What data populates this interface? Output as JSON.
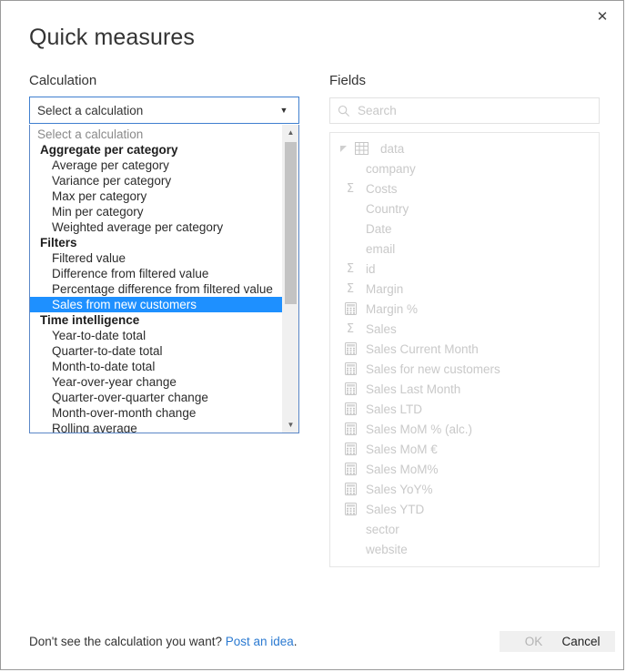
{
  "dialog": {
    "title": "Quick measures",
    "close_icon": "close-icon"
  },
  "calculation": {
    "label": "Calculation",
    "selected_value": "Select a calculation",
    "dropdown_arrow_icon": "chevron-down-icon",
    "scrollbar": {
      "up_arrow_icon": "scroll-up-arrow-icon",
      "down_arrow_icon": "scroll-down-arrow-icon"
    },
    "options": [
      {
        "label": "Select a calculation",
        "type": "placeholder",
        "selected": false
      },
      {
        "label": "Aggregate per category",
        "type": "group",
        "selected": false
      },
      {
        "label": "Average per category",
        "type": "item",
        "selected": false
      },
      {
        "label": "Variance per category",
        "type": "item",
        "selected": false
      },
      {
        "label": "Max per category",
        "type": "item",
        "selected": false
      },
      {
        "label": "Min per category",
        "type": "item",
        "selected": false
      },
      {
        "label": "Weighted average per category",
        "type": "item",
        "selected": false
      },
      {
        "label": "Filters",
        "type": "group",
        "selected": false
      },
      {
        "label": "Filtered value",
        "type": "item",
        "selected": false
      },
      {
        "label": "Difference from filtered value",
        "type": "item",
        "selected": false
      },
      {
        "label": "Percentage difference from filtered value",
        "type": "item",
        "selected": false
      },
      {
        "label": "Sales from new customers",
        "type": "item",
        "selected": true
      },
      {
        "label": "Time intelligence",
        "type": "group",
        "selected": false
      },
      {
        "label": "Year-to-date total",
        "type": "item",
        "selected": false
      },
      {
        "label": "Quarter-to-date total",
        "type": "item",
        "selected": false
      },
      {
        "label": "Month-to-date total",
        "type": "item",
        "selected": false
      },
      {
        "label": "Year-over-year change",
        "type": "item",
        "selected": false
      },
      {
        "label": "Quarter-over-quarter change",
        "type": "item",
        "selected": false
      },
      {
        "label": "Month-over-month change",
        "type": "item",
        "selected": false
      },
      {
        "label": "Rolling average",
        "type": "item",
        "selected": false
      }
    ]
  },
  "fields": {
    "label": "Fields",
    "search": {
      "placeholder": "Search",
      "value": "",
      "icon": "search-icon"
    },
    "table": {
      "name": "data",
      "expander_icon": "triangle-expanded-icon",
      "table_icon": "table-icon",
      "expanded": true
    },
    "items": [
      {
        "label": "company",
        "icon": "none"
      },
      {
        "label": "Costs",
        "icon": "sigma-icon"
      },
      {
        "label": "Country",
        "icon": "none"
      },
      {
        "label": "Date",
        "icon": "none"
      },
      {
        "label": "email",
        "icon": "none"
      },
      {
        "label": "id",
        "icon": "sigma-icon"
      },
      {
        "label": "Margin",
        "icon": "sigma-icon"
      },
      {
        "label": "Margin %",
        "icon": "measure-icon"
      },
      {
        "label": "Sales",
        "icon": "sigma-icon"
      },
      {
        "label": "Sales Current Month",
        "icon": "measure-icon"
      },
      {
        "label": "Sales for new customers",
        "icon": "measure-icon"
      },
      {
        "label": "Sales Last Month",
        "icon": "measure-icon"
      },
      {
        "label": "Sales LTD",
        "icon": "measure-icon"
      },
      {
        "label": "Sales MoM % (alc.)",
        "icon": "measure-icon"
      },
      {
        "label": "Sales MoM €",
        "icon": "measure-icon"
      },
      {
        "label": "Sales MoM%",
        "icon": "measure-icon"
      },
      {
        "label": "Sales YoY%",
        "icon": "measure-icon"
      },
      {
        "label": "Sales YTD",
        "icon": "measure-icon"
      },
      {
        "label": "sector",
        "icon": "none"
      },
      {
        "label": "website",
        "icon": "none"
      }
    ]
  },
  "footer": {
    "note_text": "Don't see the calculation you want? ",
    "link_text": "Post an idea",
    "note_suffix": ".",
    "ok_label": "OK",
    "cancel_label": "Cancel",
    "ok_enabled": false
  },
  "colors": {
    "accent_blue": "#1e90ff",
    "link_blue": "#2b7ad1",
    "combo_border": "#3f7fcf",
    "disabled_text": "#c9c9c9"
  }
}
